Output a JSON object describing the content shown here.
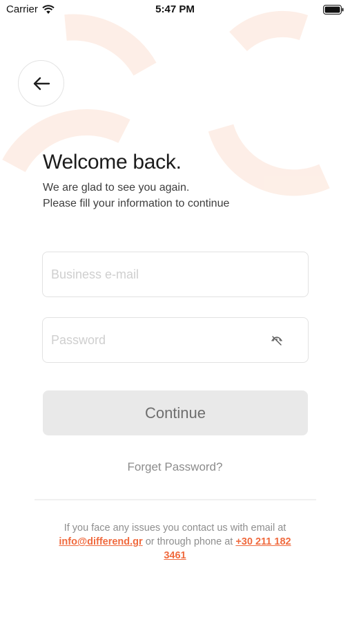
{
  "status_bar": {
    "carrier": "Carrier",
    "time": "5:47 PM",
    "wifi_icon": "wifi-icon",
    "battery_icon": "battery-icon"
  },
  "header": {
    "back_icon": "arrow-left-icon"
  },
  "login": {
    "title": "Welcome back.",
    "subtitle_line1": "We are glad to see you again.",
    "subtitle_line2": "Please fill your information to continue",
    "email_placeholder": "Business e-mail",
    "email_value": "",
    "password_placeholder": "Password",
    "password_value": "",
    "password_toggle_icon": "eye-off-icon",
    "continue_label": "Continue",
    "forget_label": "Forget Password?"
  },
  "footer": {
    "text_part1": "If you face any issues you contact us with email at",
    "email_link": "info@differend.gr",
    "text_part2": " or through phone at ",
    "phone_link": "+30 211 182 3461"
  },
  "colors": {
    "accent": "#f06a3e",
    "decor": "#fde9df",
    "button_bg": "#e9e9e9",
    "button_text": "#6e6e6e"
  }
}
